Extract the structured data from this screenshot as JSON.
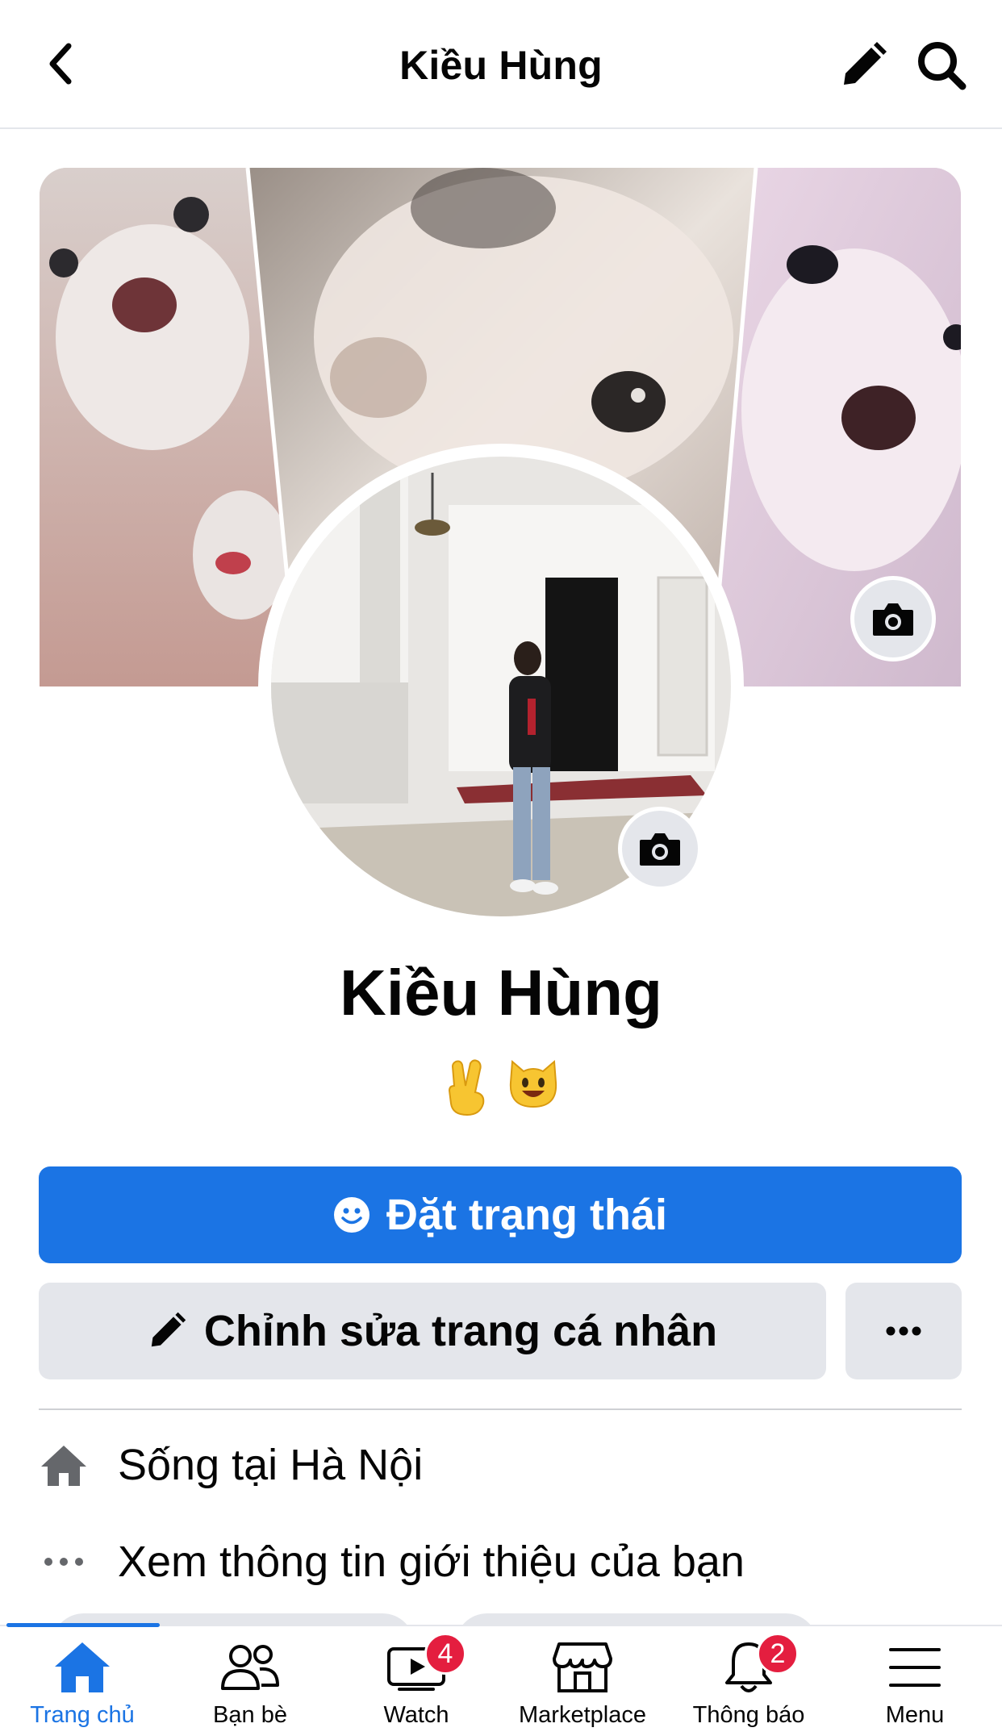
{
  "header": {
    "title": "Kiều Hùng",
    "back_icon": "chevron-left-icon",
    "edit_icon": "pencil-icon",
    "search_icon": "search-icon"
  },
  "profile": {
    "name": "Kiều Hùng",
    "emojis": [
      "victory-hand-emoji",
      "grinning-cat-emoji"
    ]
  },
  "actions": {
    "primary_label": "Đặt trạng thái",
    "edit_label": "Chỉnh sửa trang cá nhân",
    "more_icon": "ellipsis-icon"
  },
  "intro": [
    {
      "icon": "home-icon",
      "text": "Sống tại Hà Nội"
    },
    {
      "icon": "ellipsis-icon",
      "text": "Xem thông tin giới thiệu của bạn"
    }
  ],
  "tabs": [
    {
      "label": "Trang chủ",
      "icon": "home-icon",
      "active": true
    },
    {
      "label": "Bạn bè",
      "icon": "friends-icon"
    },
    {
      "label": "Watch",
      "icon": "watch-icon",
      "badge": "4"
    },
    {
      "label": "Marketplace",
      "icon": "marketplace-icon"
    },
    {
      "label": "Thông báo",
      "icon": "bell-icon",
      "badge": "2"
    },
    {
      "label": "Menu",
      "icon": "menu-icon"
    }
  ],
  "colors": {
    "accent": "#1b74e4",
    "badge": "#e41e3f",
    "secondary_button": "#e4e6eb"
  }
}
